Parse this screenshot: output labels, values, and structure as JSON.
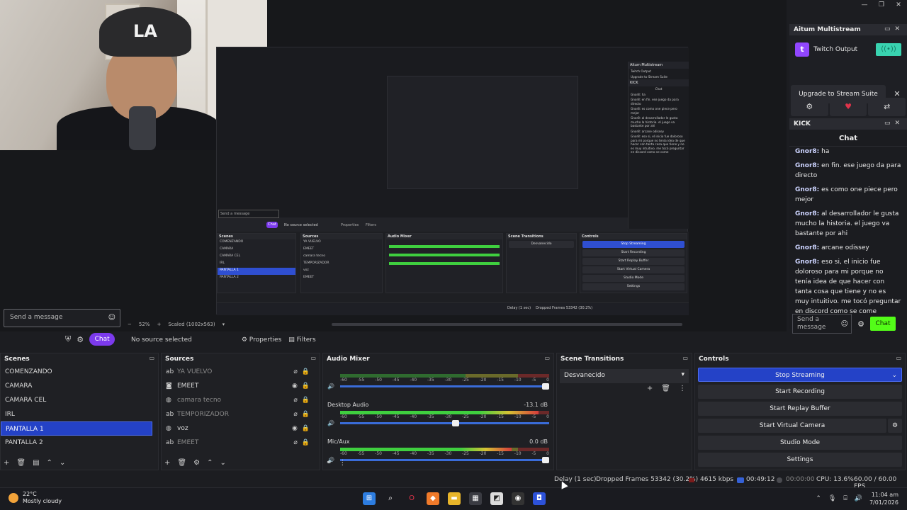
{
  "window": {
    "controls": [
      "—",
      "❐",
      "✕"
    ]
  },
  "left_chat": {
    "placeholder": "Send a message",
    "chat_label": "Chat"
  },
  "zoom": {
    "minus": "−",
    "level": "52%",
    "plus": "+",
    "scaled": "Scaled (1002x563)"
  },
  "source_toolbar": {
    "status": "No source selected",
    "properties": "Properties",
    "filters": "Filters"
  },
  "multistream": {
    "title": "Aitum Multistream",
    "twitch_label": "Twitch Output",
    "upgrade_label": "Upgrade to Stream Suite"
  },
  "kick": {
    "title": "KICK",
    "chat_title": "Chat",
    "messages": [
      {
        "user": "Gnor8:",
        "text": "ha"
      },
      {
        "user": "Gnor8:",
        "text": "en fin. ese juego da para directo"
      },
      {
        "user": "Gnor8:",
        "text": "es como one piece pero mejor"
      },
      {
        "user": "Gnor8:",
        "text": "al desarrollador le gusta mucho la historia. el juego va bastante por ahi"
      },
      {
        "user": "Gnor8:",
        "text": "arcane odissey"
      },
      {
        "user": "Gnor8:",
        "text": "eso si, el inicio fue doloroso para mi porque no tenía idea de que hacer con tanta cosa que tiene y no es muy intuitivo. me tocó preguntar en discord como se come"
      }
    ],
    "input_placeholder": "Send a message",
    "chat_button": "Chat"
  },
  "scenes": {
    "title": "Scenes",
    "items": [
      "COMENZANDO",
      "CAMARA",
      "CAMARA CEL",
      "IRL",
      "PANTALLA 1",
      "PANTALLA 2"
    ],
    "selected": "PANTALLA 1"
  },
  "sources": {
    "title": "Sources",
    "items": [
      {
        "name": "YA VUELVO",
        "visible": false
      },
      {
        "name": "EMEET",
        "visible": true
      },
      {
        "name": "camara tecno",
        "visible": false
      },
      {
        "name": "TEMPORIZADOR",
        "visible": false
      },
      {
        "name": "voz",
        "visible": true
      },
      {
        "name": "EMEET",
        "visible": false
      }
    ]
  },
  "mixer": {
    "title": "Audio Mixer",
    "scale": [
      "-60",
      "-55",
      "-50",
      "-45",
      "-40",
      "-35",
      "-30",
      "-25",
      "-20",
      "-15",
      "-10",
      "-5",
      "0"
    ],
    "channels": [
      {
        "name": "",
        "db": "",
        "level": 0.0,
        "volume": 1.0
      },
      {
        "name": "Desktop Audio",
        "db": "-13.1 dB",
        "level": 0.95,
        "volume": 0.57
      },
      {
        "name": "Mic/Aux",
        "db": "0.0 dB",
        "level": 0.82,
        "volume": 1.0
      }
    ]
  },
  "transitions": {
    "title": "Scene Transitions",
    "selected": "Desvanecido"
  },
  "controls": {
    "title": "Controls",
    "buttons": [
      "Stop Streaming",
      "Start Recording",
      "Start Replay Buffer",
      "Start Virtual Camera",
      "Studio Mode",
      "Settings"
    ]
  },
  "status": {
    "delay": "Delay (1 sec)",
    "dropped": "Dropped Frames 53342 (30.2%)",
    "bitrate": "4615 kbps",
    "live_time": "00:49:12",
    "rec_time": "00:00:00",
    "cpu": "CPU: 13.6%",
    "fps": "60.00 / 60.00 FPS"
  },
  "taskbar": {
    "temp": "22°C",
    "weather": "Mostly cloudy",
    "time": "11:04 am",
    "date": "7/01/2026"
  },
  "mini": {
    "send": "Send a message",
    "chat": "Chat",
    "multistream": "Aitum Multistream",
    "twitch": "Twitch Output",
    "upgrade": "Upgrade to Stream Suite",
    "kick": "KICK",
    "chat_title": "Chat",
    "scenes": "Scenes",
    "sources": "Sources",
    "mixer": "Audio Mixer",
    "transitions": "Scene Transitions",
    "controls": "Controls",
    "trans_sel": "Desvanecido",
    "scene_items": [
      "COMENZANDO",
      "CAMARA",
      "CAMARA CEL",
      "IRL",
      "PANTALLA 1",
      "PANTALLA 2"
    ],
    "source_items": [
      "YA VUELVO",
      "EMEET",
      "camara tecno",
      "TEMPORIZADOR",
      "voz",
      "EMEET"
    ],
    "ctrl_items": [
      "Stop Streaming",
      "Start Recording",
      "Start Replay Buffer",
      "Start Virtual Camera",
      "Studio Mode",
      "Settings"
    ],
    "chat_lines": [
      "Gnor8: ha",
      "Gnor8: en fin. ese juego da para directo",
      "Gnor8: es como one piece pero mejor",
      "Gnor8: al desarrollador le gusta mucho la historia. el juego va bastante por ahi",
      "Gnor8: arcane odissey",
      "Gnor8: eso si, el inicio fue doloroso para mi porque no tenía idea de que hacer con tanta cosa que tiene y no es muy intuitivo. me tocó preguntar en discord como se come"
    ],
    "no_source": "No source selected",
    "properties": "Properties",
    "filters": "Filters",
    "delay": "Delay (1 sec)",
    "dropped": "Dropped Frames 53342 (30.2%)"
  }
}
